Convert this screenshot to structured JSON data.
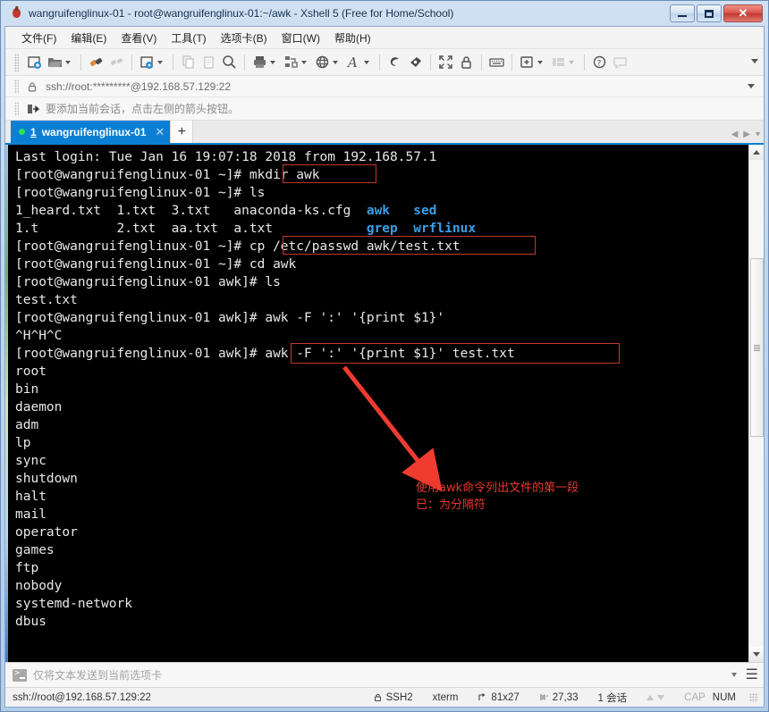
{
  "window": {
    "title": "wangruifenglinux-01 - root@wangruifenglinux-01:~/awk - Xshell 5 (Free for Home/School)",
    "minimize_label": "",
    "maximize_label": "",
    "close_label": "✕"
  },
  "menu": {
    "items": [
      {
        "label": "文件(F)"
      },
      {
        "label": "编辑(E)"
      },
      {
        "label": "查看(V)"
      },
      {
        "label": "工具(T)"
      },
      {
        "label": "选项卡(B)"
      },
      {
        "label": "窗口(W)"
      },
      {
        "label": "帮助(H)"
      }
    ]
  },
  "toolbar": {
    "icons": [
      "new-session-icon",
      "open-folder-icon",
      "connect-icon",
      "disconnect-icon",
      "session-properties-icon",
      "copy-icon",
      "paste-icon",
      "find-icon",
      "print-icon",
      "transfer-icon",
      "web-icon",
      "font-icon",
      "xftp-icon",
      "xagent-icon",
      "fullscreen-icon",
      "lock-icon",
      "keyboard-icon",
      "new-tab-icon",
      "arrange-icon",
      "help-icon",
      "comment-icon"
    ]
  },
  "address_bar": {
    "value": "ssh://root:*********@192.168.57.129:22",
    "lock_icon": "lock-icon"
  },
  "session_bar": {
    "text": "要添加当前会话，点击左侧的箭头按钮。",
    "icon": "add-session-icon"
  },
  "tabs": {
    "active": {
      "number": "1",
      "label": "wangruifenglinux-01",
      "close_label": "✕"
    },
    "new_tab_label": "+"
  },
  "terminal": {
    "lines": [
      [
        {
          "t": "Last login: Tue Jan 16 19:07:18 2018 from 192.168.57.1",
          "c": "w"
        }
      ],
      [
        {
          "t": "[root@wangruifenglinux-01 ~]# mkdir awk",
          "c": "w"
        }
      ],
      [
        {
          "t": "[root@wangruifenglinux-01 ~]# ls",
          "c": "w"
        }
      ],
      [
        {
          "t": "1_heard.txt  1.txt  3.txt   anaconda-ks.cfg  ",
          "c": "w"
        },
        {
          "t": "awk   sed",
          "c": "b"
        }
      ],
      [
        {
          "t": "1.t          2.txt  aa.txt  a.txt            ",
          "c": "w"
        },
        {
          "t": "grep  wrflinux",
          "c": "b"
        }
      ],
      [
        {
          "t": "[root@wangruifenglinux-01 ~]# cp /etc/passwd awk/test.txt",
          "c": "w"
        }
      ],
      [
        {
          "t": "[root@wangruifenglinux-01 ~]# cd awk",
          "c": "w"
        }
      ],
      [
        {
          "t": "[root@wangruifenglinux-01 awk]# ls",
          "c": "w"
        }
      ],
      [
        {
          "t": "test.txt",
          "c": "w"
        }
      ],
      [
        {
          "t": "[root@wangruifenglinux-01 awk]# awk -F ':' '{print $1}'",
          "c": "w"
        }
      ],
      [
        {
          "t": "^H^H^C",
          "c": "w"
        }
      ],
      [
        {
          "t": "[root@wangruifenglinux-01 awk]# awk -F ':' '{print $1}' test.txt",
          "c": "w"
        }
      ],
      [
        {
          "t": "root",
          "c": "w"
        }
      ],
      [
        {
          "t": "bin",
          "c": "w"
        }
      ],
      [
        {
          "t": "daemon",
          "c": "w"
        }
      ],
      [
        {
          "t": "adm",
          "c": "w"
        }
      ],
      [
        {
          "t": "lp",
          "c": "w"
        }
      ],
      [
        {
          "t": "sync",
          "c": "w"
        }
      ],
      [
        {
          "t": "shutdown",
          "c": "w"
        }
      ],
      [
        {
          "t": "halt",
          "c": "w"
        }
      ],
      [
        {
          "t": "mail",
          "c": "w"
        }
      ],
      [
        {
          "t": "operator",
          "c": "w"
        }
      ],
      [
        {
          "t": "games",
          "c": "w"
        }
      ],
      [
        {
          "t": "ftp",
          "c": "w"
        }
      ],
      [
        {
          "t": "nobody",
          "c": "w"
        }
      ],
      [
        {
          "t": "systemd-network",
          "c": "w"
        }
      ],
      [
        {
          "t": "dbus",
          "c": "w"
        }
      ]
    ],
    "highlight_color": "#c0392b",
    "annotation_color": "#e8372c",
    "annotation_text": "使用awk命令列出文件的第一段\n已：为分隔符",
    "dir_color": "#3b9fe8",
    "text_color": "#e8e8e8",
    "background": "#000000"
  },
  "send_bar": {
    "placeholder": "仅将文本发送到当前选项卡",
    "menu_label": "☰"
  },
  "status_bar": {
    "connection": "ssh://root@192.168.57.129:22",
    "protocol": "SSH2",
    "terminal_type": "xterm",
    "size": "81x27",
    "cursor": "27,33",
    "sessions": "1 会话",
    "caps": "CAP",
    "num": "NUM"
  }
}
